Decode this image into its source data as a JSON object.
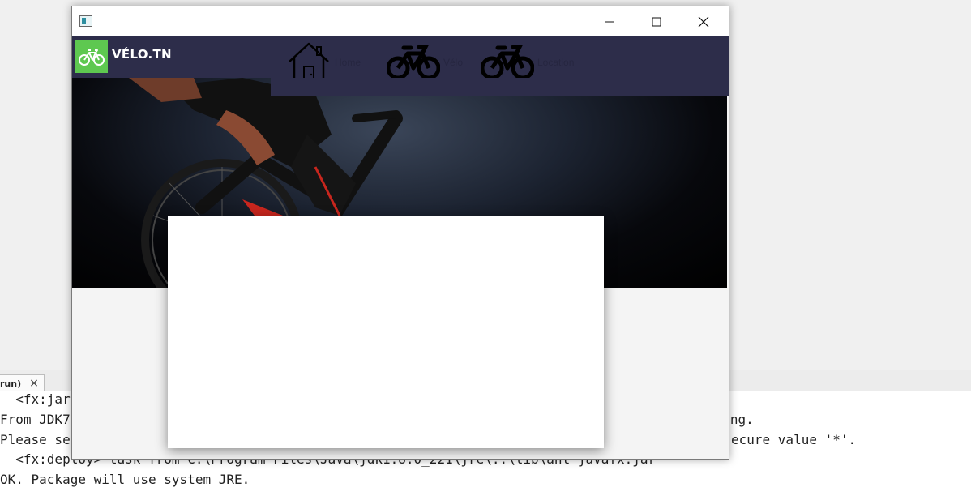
{
  "ide": {
    "output_tab_label": "run)",
    "output_tab_close": "×",
    "output_lines": [
      "  <fx:jar>",
      "From JDK7",
      "Please se",
      "  <fx:deploy> task from C:\\Program Files\\Java\\jdk1.8.0_221\\jre\\..\\lib\\ant-javafx.jar",
      "OK. Package will use system JRE."
    ],
    "output_fragments": {
      "line2_end": "osing.",
      "line3_end": "ecure value '*'."
    }
  },
  "app": {
    "brand": "VÉLO.TN",
    "nav_items": [
      {
        "icon": "house-icon",
        "label": "Home"
      },
      {
        "icon": "bicycle-icon",
        "label": "Vélo"
      },
      {
        "icon": "bicycle-icon",
        "label": "Location"
      }
    ],
    "colors": {
      "nav_bg": "#2d2d4a",
      "logo_bg": "#5ec850",
      "brand_text": "#ffffff"
    }
  }
}
